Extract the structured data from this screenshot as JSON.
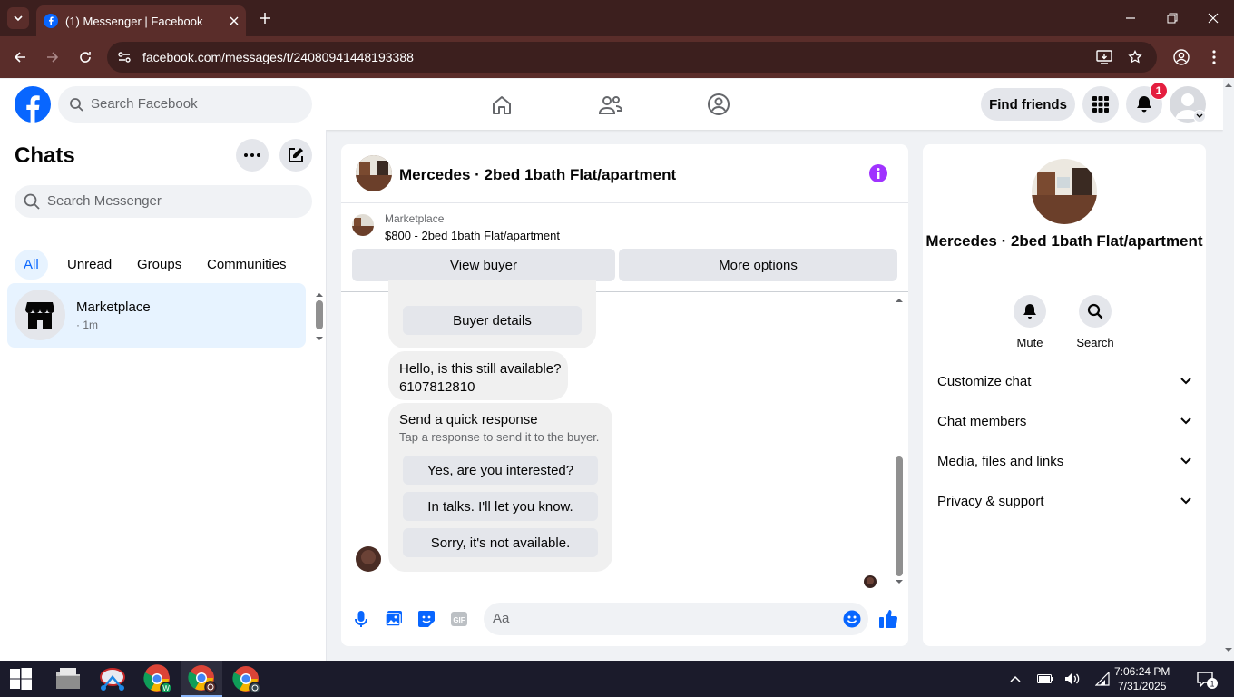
{
  "browser": {
    "tab_title": "(1) Messenger | Facebook",
    "url": "facebook.com/messages/t/24080941448193388"
  },
  "header": {
    "search_placeholder": "Search Facebook",
    "find_friends": "Find friends",
    "notification_count": "1"
  },
  "sidebar": {
    "title": "Chats",
    "search_placeholder": "Search Messenger",
    "filters": [
      "All",
      "Unread",
      "Groups",
      "Communities"
    ],
    "chats": [
      {
        "name": "Marketplace",
        "time": "· 1m"
      }
    ]
  },
  "conversation": {
    "title": "Mercedes · 2bed 1bath Flat/apartment",
    "marketplace_label": "Marketplace",
    "listing": "$800 - 2bed 1bath Flat/apartment",
    "view_buyer": "View buyer",
    "more_options": "More options",
    "buyer_details": "Buyer details",
    "message_line1": "Hello, is this still available?",
    "message_line2": "6107812810",
    "quick_title": "Send a quick response",
    "quick_subtitle": "Tap a response to send it to the buyer.",
    "quick_responses": [
      "Yes, are you interested?",
      "In talks. I'll let you know.",
      "Sorry, it's not available."
    ],
    "composer_placeholder": "Aa"
  },
  "details": {
    "name": "Mercedes · 2bed 1bath Flat/apartment",
    "mute": "Mute",
    "search": "Search",
    "sections": [
      "Customize chat",
      "Chat members",
      "Media, files and links",
      "Privacy & support"
    ]
  },
  "taskbar": {
    "time": "7:06:24 PM",
    "date": "7/31/2025",
    "notification_count": "1"
  },
  "colors": {
    "fb_blue": "#0866ff",
    "messenger_purple": "#a033ff",
    "chrome_bg": "#3c1f1e"
  }
}
